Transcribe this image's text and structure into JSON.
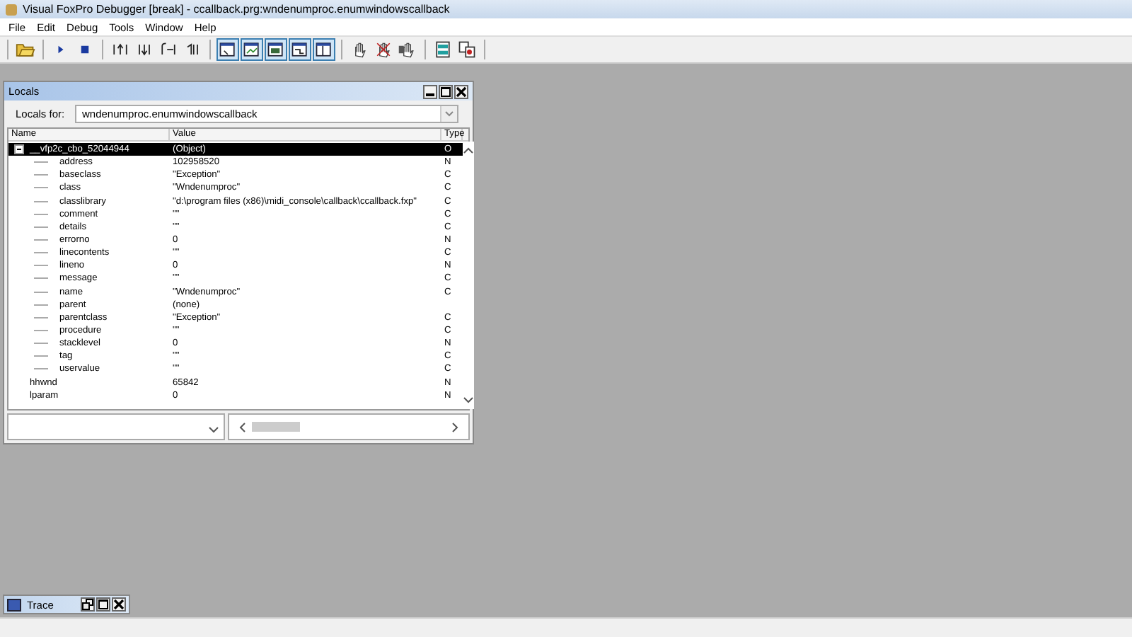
{
  "window": {
    "title": "Visual FoxPro Debugger [break] - ccallback.prg:wndenumproc.enumwindowscallback"
  },
  "menu": [
    "File",
    "Edit",
    "Debug",
    "Tools",
    "Window",
    "Help"
  ],
  "toolbar": [
    [
      {
        "pressed": false
      }
    ],
    [
      {
        "pressed": false
      },
      {
        "pressed": false
      }
    ],
    [
      {
        "pressed": false
      },
      {
        "pressed": false
      },
      {
        "pressed": false
      },
      {
        "pressed": false
      }
    ],
    [
      {
        "pressed": true
      },
      {
        "pressed": true
      },
      {
        "pressed": true
      },
      {
        "pressed": true
      },
      {
        "pressed": true
      }
    ],
    [
      {
        "pressed": false
      },
      {
        "pressed": false
      },
      {
        "pressed": false
      }
    ],
    [
      {
        "pressed": false
      },
      {
        "pressed": false
      }
    ]
  ],
  "locals": {
    "title": "Locals",
    "locals_for_label": "Locals for:",
    "locals_for_value": "wndenumproc.enumwindowscallback",
    "columns": [
      "Name",
      "Value",
      "Type"
    ],
    "rows": [
      {
        "name": "__vfp2c_cbo_52044944",
        "value": "(Object)",
        "type": "O",
        "selected": true,
        "expanded": true,
        "children": [
          {
            "name": "address",
            "value": "102958520",
            "type": "N",
            "selected": false
          },
          {
            "name": "baseclass",
            "value": "\"Exception\"",
            "type": "C",
            "selected": false
          },
          {
            "name": "class",
            "value": "\"Wndenumproc\"",
            "type": "C",
            "selected": false
          },
          {
            "name": "classlibrary",
            "value": "\"d:\\program files (x86)\\midi_console\\callback\\ccallback.fxp\"",
            "type": "C",
            "selected": false
          },
          {
            "name": "comment",
            "value": "\"\"",
            "type": "C",
            "selected": false
          },
          {
            "name": "details",
            "value": "\"\"",
            "type": "C",
            "selected": false
          },
          {
            "name": "errorno",
            "value": "0",
            "type": "N",
            "selected": false
          },
          {
            "name": "linecontents",
            "value": "\"\"",
            "type": "C",
            "selected": false
          },
          {
            "name": "lineno",
            "value": "0",
            "type": "N",
            "selected": false
          },
          {
            "name": "message",
            "value": "\"\"",
            "type": "C",
            "selected": false
          },
          {
            "name": "name",
            "value": "\"Wndenumproc\"",
            "type": "C",
            "selected": false
          },
          {
            "name": "parent",
            "value": "(none)",
            "selected": false
          },
          {
            "name": "parentclass",
            "value": "\"Exception\"",
            "type": "C",
            "selected": false
          },
          {
            "name": "procedure",
            "value": "\"\"",
            "type": "C",
            "selected": false
          },
          {
            "name": "stacklevel",
            "value": "0",
            "type": "N",
            "selected": false
          },
          {
            "name": "tag",
            "value": "\"\"",
            "type": "C",
            "selected": false
          },
          {
            "name": "uservalue",
            "value": "\"\"",
            "type": "C",
            "selected": false
          }
        ]
      },
      {
        "name": "hhwnd",
        "value": "65842",
        "type": "N",
        "selected": false
      },
      {
        "name": "lparam",
        "value": "0",
        "type": "N",
        "selected": false
      }
    ]
  },
  "trace": {
    "title": "Trace"
  }
}
